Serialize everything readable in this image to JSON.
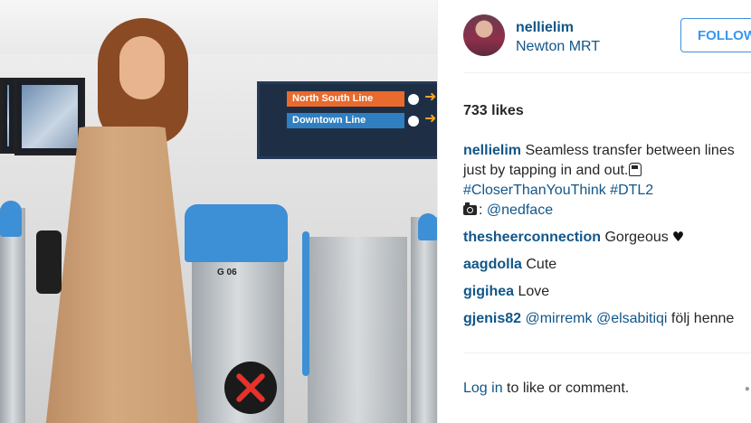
{
  "post": {
    "username": "nellielim",
    "location": "Newton MRT",
    "follow_label": "FOLLOW",
    "likes": "733 likes",
    "caption": {
      "username": "nellielim",
      "line1": "Seamless transfer between lines",
      "line2": "just by tapping in and out.",
      "hashtags": "#CloserThanYouThink #DTL2",
      "credit_sep": ":",
      "credit_handle": "@nedface"
    },
    "comments": [
      {
        "username": "thesheerconnection",
        "text": "Gorgeous"
      },
      {
        "username": "aagdolla",
        "text": "Cute"
      },
      {
        "username": "gigihea",
        "text": "Love"
      },
      {
        "username": "gjenis82",
        "mention1": "@mirremk",
        "mention2": "@elsabitiqi",
        "text": "följ henne"
      }
    ],
    "login_link": "Log in",
    "login_text": "to like or comment."
  },
  "photo": {
    "sign_line_1": "North South Line",
    "sign_line_2": "Downtown Line",
    "gate_label": "G 06"
  },
  "colors": {
    "link_blue": "#125688",
    "follow_blue": "#3897f0",
    "text": "#262626",
    "north_south": "#e86a2c",
    "downtown": "#2f7fc1"
  },
  "icons": [
    "camera-icon",
    "train-emoji-icon",
    "heart-icon",
    "more-options-icon"
  ]
}
